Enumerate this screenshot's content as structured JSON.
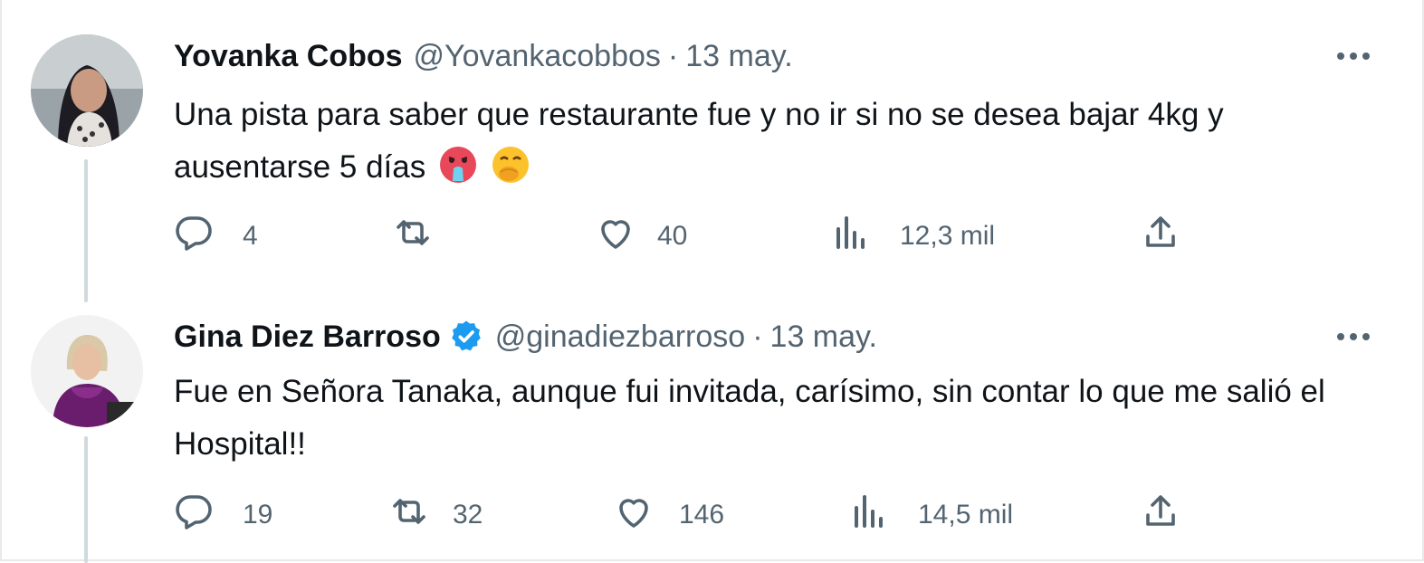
{
  "tweets": [
    {
      "name": "Yovanka Cobos",
      "handle": "@Yovankacobbos",
      "separator": "·",
      "date": "13 may.",
      "verified": false,
      "text": "Una pista para saber que restaurante fue y no ir si no se desea bajar 4kg y ausentarse 5 días",
      "emojis": [
        "face-vomiting-emoji",
        "face-with-hand-over-mouth-emoji"
      ],
      "stats": {
        "replies": "4",
        "retweets": "",
        "likes": "40",
        "views": "12,3 mil"
      }
    },
    {
      "name": "Gina Diez Barroso",
      "handle": "@ginadiezbarroso",
      "separator": "·",
      "date": "13 may.",
      "verified": true,
      "text": "Fue en Señora Tanaka, aunque fui invitada, carísimo, sin contar lo que me salió el Hospital!!",
      "emojis": [],
      "stats": {
        "replies": "19",
        "retweets": "32",
        "likes": "146",
        "views": "14,5 mil"
      }
    }
  ],
  "colors": {
    "text_primary": "#0f1419",
    "text_secondary": "#536471",
    "verified_blue": "#1d9bf0",
    "thread_line": "#cfd9de"
  }
}
